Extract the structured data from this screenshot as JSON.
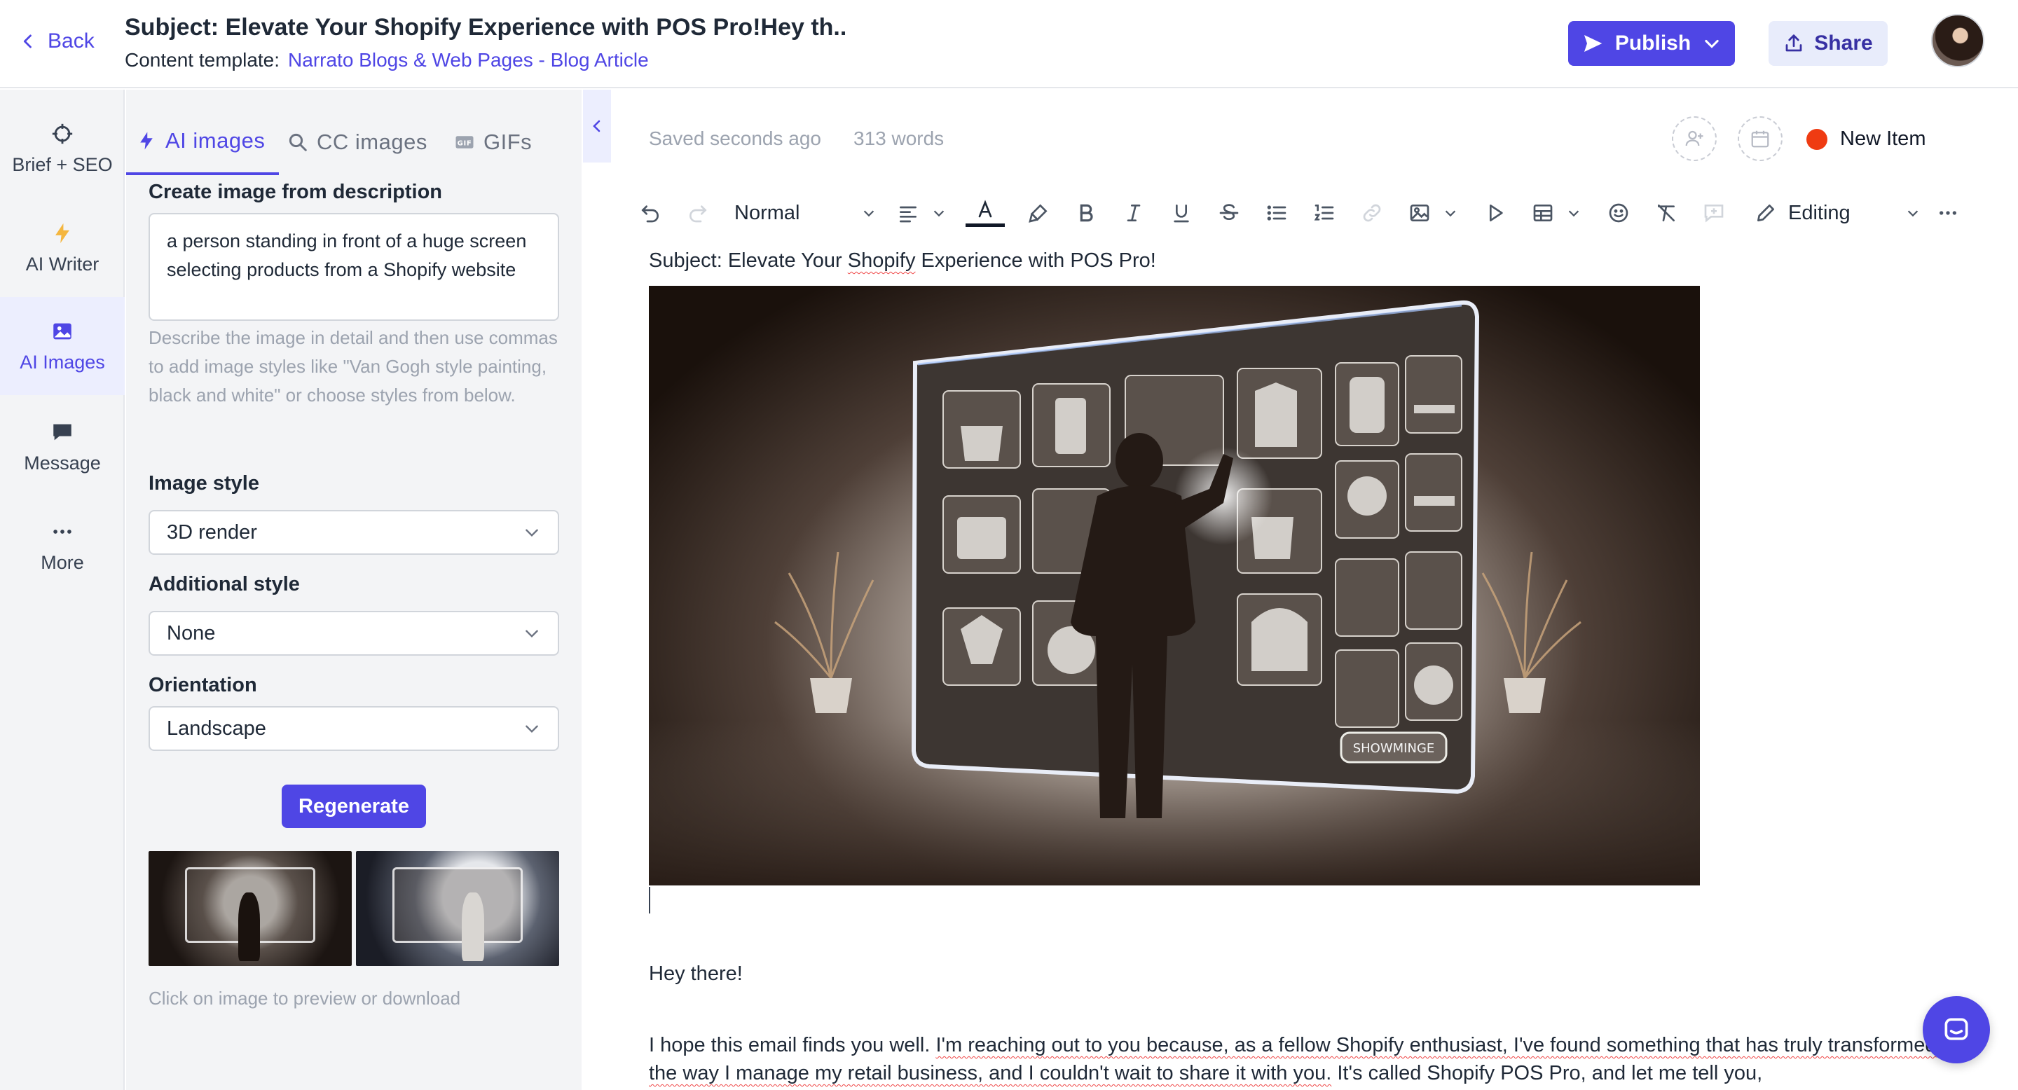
{
  "header": {
    "back_label": "Back",
    "title": "Subject: Elevate Your Shopify Experience with POS Pro!Hey th..",
    "template_label": "Content template:",
    "template_link": "Narrato Blogs & Web Pages - Blog Article",
    "publish_label": "Publish",
    "share_label": "Share"
  },
  "rail": {
    "items": [
      {
        "label": "Brief + SEO",
        "icon": "crosshair-icon"
      },
      {
        "label": "AI Writer",
        "icon": "bolt-icon"
      },
      {
        "label": "AI Images",
        "icon": "image-icon",
        "active": true
      },
      {
        "label": "Message",
        "icon": "message-icon"
      },
      {
        "label": "More",
        "icon": "more-icon"
      }
    ]
  },
  "panel": {
    "tabs": [
      {
        "label": "AI images",
        "icon": "bolt-icon",
        "active": true
      },
      {
        "label": "CC images",
        "icon": "search-icon"
      },
      {
        "label": "GIFs",
        "icon": "gif-icon"
      }
    ],
    "create_label": "Create image from description",
    "description_value": "a person standing in front of a huge screen selecting products from a Shopify website",
    "hint": "Describe the image in detail and then use commas to add image styles like \"Van Gogh style painting, black and white\" or choose styles from below.",
    "image_style_label": "Image style",
    "image_style_value": "3D render",
    "additional_style_label": "Additional style",
    "additional_style_value": "None",
    "orientation_label": "Orientation",
    "orientation_value": "Landscape",
    "regenerate_label": "Regenerate",
    "click_hint": "Click on image to preview or download"
  },
  "editor": {
    "status": "Saved seconds ago",
    "word_count": "313 words",
    "new_item_label": "New Item",
    "status_color": "#ef3b12",
    "toolbar": {
      "paragraph_style": "Normal",
      "mode": "Editing"
    },
    "subject_prefix": "Subject: Elevate Your ",
    "subject_brand": "Shopify",
    "subject_suffix": " Experience with POS Pro!",
    "image_screen_button": "SHOWMINGE",
    "greeting": "Hey there!",
    "body_plain": "I hope this email finds you well. ",
    "body_flagged": "I'm reaching out to you because, as a fellow Shopify enthusiast, I've found something that has truly transformed the way I manage my retail business, and I couldn't wait to share it with you.",
    "body_tail": " It's called Shopify POS Pro, and let me tell you,"
  },
  "colors": {
    "accent": "#4f46e5",
    "accent_light": "#eceefe",
    "rail_bg": "#f3f4f6"
  }
}
